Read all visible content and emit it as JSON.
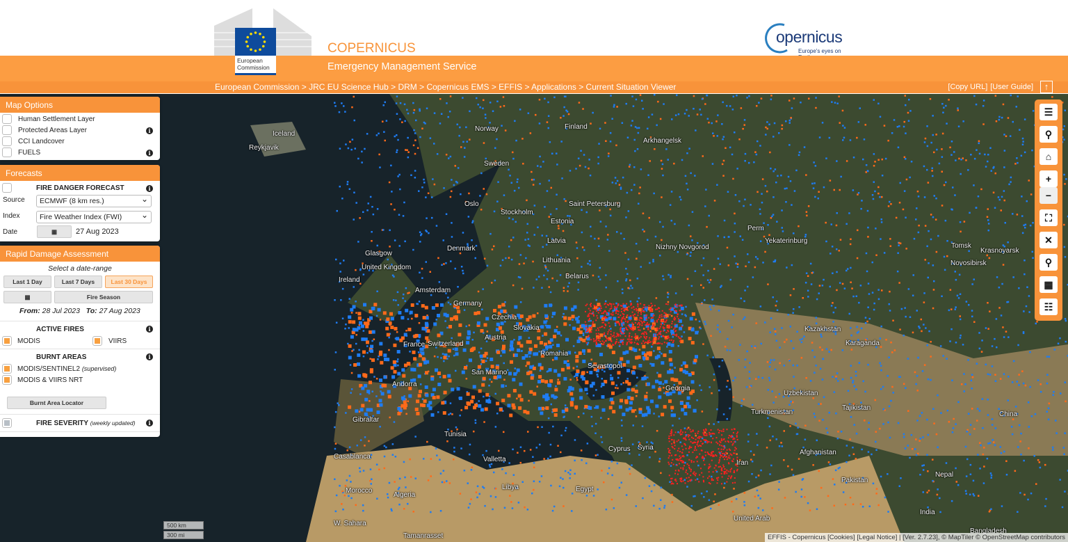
{
  "header": {
    "ec_logo_text": "European Commission",
    "title": "COPERNICUS",
    "subtitle": "Emergency Management Service",
    "copernicus_logo": "opernicus",
    "copernicus_tagline": "Europe's eyes on Earth",
    "breadcrumb": "European Commission > JRC EU Science Hub > DRM > Copernicus EMS > EFFIS > Applications > Current Situation Viewer",
    "copy_url": "[Copy URL]",
    "user_guide": "[User Guide]",
    "up_icon": "arrow-up-icon"
  },
  "map_options": {
    "title": "Map Options",
    "items": [
      {
        "label": "Human Settlement Layer",
        "info": false
      },
      {
        "label": "Protected Areas Layer",
        "info": true
      },
      {
        "label": "CCI Landcover",
        "info": false
      },
      {
        "label": "FUELS",
        "info": true
      }
    ]
  },
  "forecasts": {
    "title": "Forecasts",
    "heading": "FIRE DANGER FORECAST",
    "source_label": "Source",
    "source_value": "ECMWF (8 km res.)",
    "index_label": "Index",
    "index_value": "Fire Weather Index (FWI)",
    "date_label": "Date",
    "date_value": "27 Aug 2023"
  },
  "rda": {
    "title": "Rapid Damage Assessment",
    "select_range": "Select a date-range",
    "last1": "Last 1 Day",
    "last7": "Last 7 Days",
    "last30": "Last 30 Days",
    "fire_season": "Fire Season",
    "from_label": "From:",
    "from_value": "28 Jul 2023",
    "to_label": "To:",
    "to_value": "27 Aug 2023",
    "active_fires": "ACTIVE FIRES",
    "modis": "MODIS",
    "viirs": "VIIRS",
    "burnt_areas": "BURNT AREAS",
    "ba1": "MODIS/SENTINEL2",
    "ba1_note": "(supervised)",
    "ba2": "MODIS & VIIRS NRT",
    "locator": "Burnt Area Locator",
    "severity": "FIRE SEVERITY",
    "severity_note": "(weekly updated)"
  },
  "toolbar": [
    "menu-icon",
    "search-icon",
    "home-icon",
    "zoom-in-icon",
    "zoom-out-icon",
    "fullscreen-icon",
    "extent-icon",
    "location-pin-icon",
    "layers-grid-icon",
    "legend-list-icon"
  ],
  "map": {
    "labels": [
      "Iceland",
      "Reykjavik",
      "Finland",
      "Norway",
      "Sweden",
      "Arkhangelsk",
      "Oslo",
      "Stockholm",
      "Saint Petersburg",
      "Estonia",
      "Latvia",
      "Perm",
      "Yekaterinburg",
      "Nizhny Novgorod",
      "Denmark",
      "Lithuania",
      "Tomsk",
      "Krasnoyarsk",
      "Novosibirsk",
      "United Kingdom",
      "Ireland",
      "Glasgow",
      "Amsterdam",
      "Belarus",
      "Germany",
      "Czechia",
      "Slovakia",
      "Kazakhstan",
      "Karaganda",
      "France",
      "Switzerland",
      "Austria",
      "Romania",
      "Sevastopol",
      "Georgia",
      "Andorra",
      "Turkmenistan",
      "Uzbekistan",
      "Tajikistan",
      "China",
      "Valletta",
      "Tunisia",
      "Gibraltar",
      "Casablanca",
      "Morocco",
      "Algeria",
      "Libya",
      "Egypt",
      "Cyprus",
      "Syria",
      "Iran",
      "Afghanistan",
      "Pakistan",
      "Nepal",
      "India",
      "W. Sahara",
      "Tamanrasset",
      "United Arab",
      "Bangladesh",
      "San Marino"
    ],
    "scale_km": "500 km",
    "scale_mi": "300 mi",
    "attribution": "EFFIS - Copernicus [Cookies] [Legal Notice] | [Ver. 2.7.23], © MapTiler © OpenStreetMap contributors",
    "colors": {
      "modis": "#ff6a1a",
      "viirs": "#1e7cf2",
      "recent": "#ff2020",
      "sea": "#17232a",
      "land": "#3c4a30",
      "desert": "#b89a66"
    }
  }
}
